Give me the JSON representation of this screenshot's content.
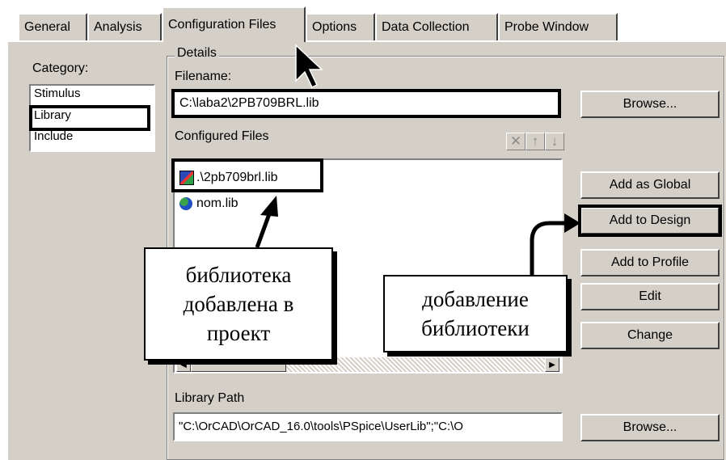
{
  "tabs": [
    {
      "label": "General"
    },
    {
      "label": "Analysis"
    },
    {
      "label": "Configuration Files"
    },
    {
      "label": "Options"
    },
    {
      "label": "Data Collection"
    },
    {
      "label": "Probe Window"
    }
  ],
  "category": {
    "label": "Category:",
    "items": [
      "Stimulus",
      "Library",
      "Include"
    ],
    "selected": "Library"
  },
  "details": {
    "group_label": "Details",
    "filename_label": "Filename:",
    "filename_value": "C:\\laba2\\2PB709BRL.lib",
    "browse_label": "Browse...",
    "configured_label": "Configured Files",
    "files": [
      ".\\2pb709brl.lib",
      "nom.lib"
    ],
    "library_path_label": "Library Path",
    "library_path_value": "\"C:\\OrCAD\\OrCAD_16.0\\tools\\PSpice\\UserLib\";\"C:\\O",
    "browse2_label": "Browse..."
  },
  "buttons": {
    "add_global": "Add as Global",
    "add_design": "Add to Design",
    "add_profile": "Add to Profile",
    "edit": "Edit",
    "change": "Change"
  },
  "callouts": {
    "left": [
      "библиотека",
      "добавлена в",
      "проект"
    ],
    "right": [
      "добавление",
      "библиотеки"
    ]
  }
}
